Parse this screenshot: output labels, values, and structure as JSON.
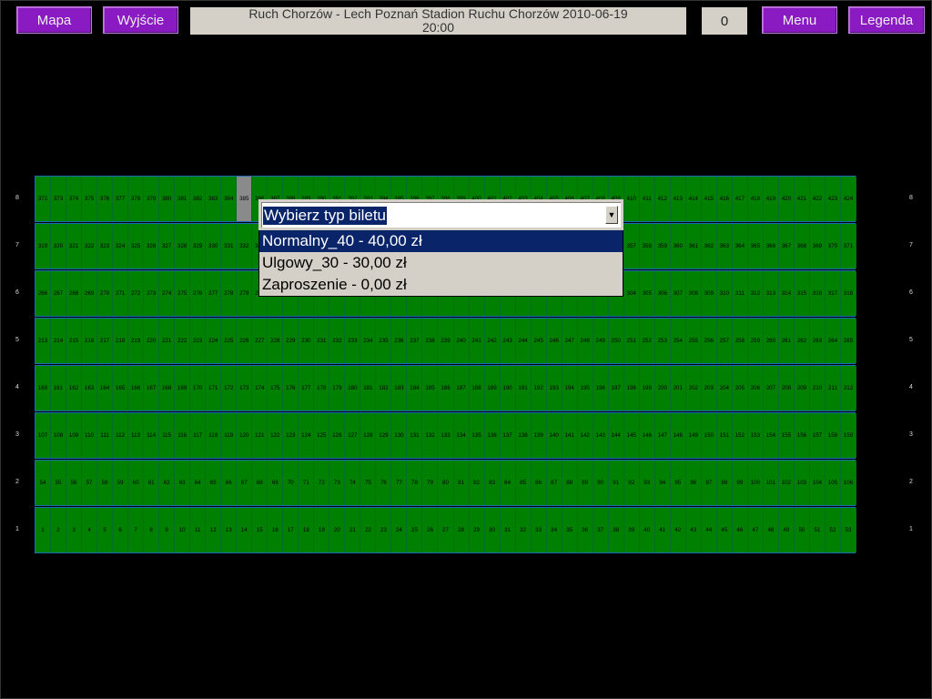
{
  "toolbar": {
    "map_label": "Mapa",
    "exit_label": "Wyjście",
    "menu_label": "Menu",
    "legend_label": "Legenda",
    "event_line1": "Ruch Chorzów - Lech Poznań   Stadion Ruchu Chorzów   2010-06-19",
    "event_line2": "20:00",
    "counter": "0"
  },
  "seating": {
    "rows": [
      {
        "label": "8",
        "start": 372,
        "end": 424
      },
      {
        "label": "7",
        "start": 319,
        "end": 371
      },
      {
        "label": "6",
        "start": 266,
        "end": 318
      },
      {
        "label": "5",
        "start": 213,
        "end": 265
      },
      {
        "label": "4",
        "start": 160,
        "end": 212
      },
      {
        "label": "3",
        "start": 107,
        "end": 159
      },
      {
        "label": "2",
        "start": 54,
        "end": 106
      },
      {
        "label": "1",
        "start": 1,
        "end": 53
      }
    ],
    "selected_seat": 385
  },
  "ticket_dropdown": {
    "placeholder": "Wybierz typ biletu",
    "options": [
      "Normalny_40 - 40,00 zł",
      "Ulgowy_30 - 30,00 zł",
      "Zaproszenie - 0,00 zł"
    ],
    "highlighted_index": 0
  },
  "colors": {
    "button": "#8a1bc2",
    "seat": "#008000",
    "selected": "#8a8a8a",
    "highlight": "#0a246a"
  }
}
